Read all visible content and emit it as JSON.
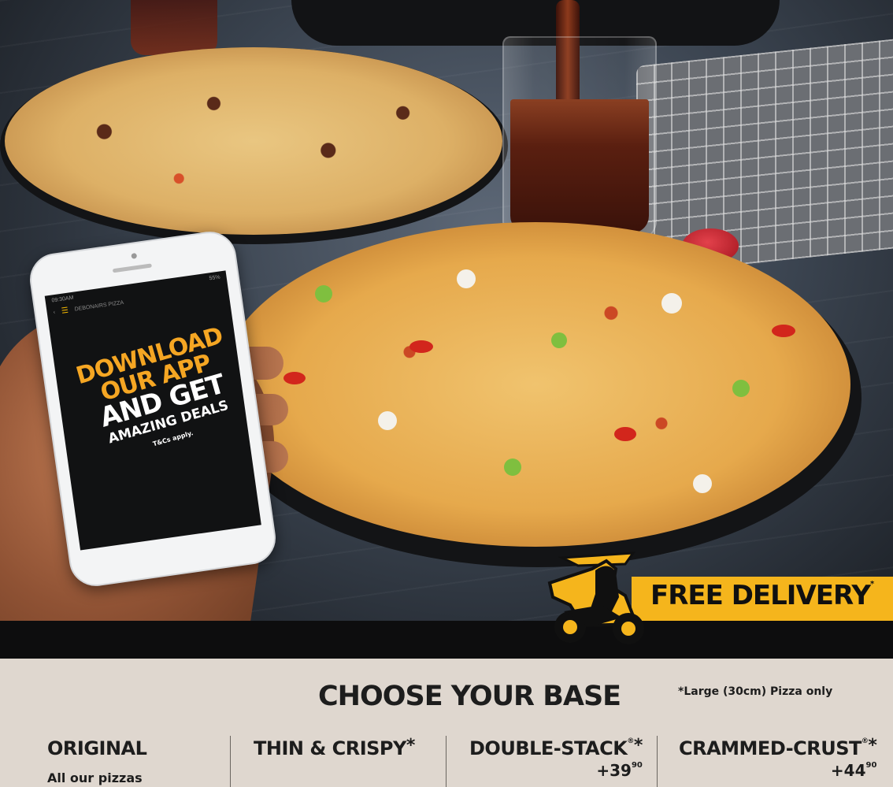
{
  "phone": {
    "status_time": "09:30AM",
    "status_right": "55%",
    "app_title": "DEBONAIRS PIZZA",
    "promo": {
      "line1": "DOWNLOAD",
      "line2": "OUR APP",
      "line3": "AND GET",
      "line4": "AMAZING DEALS",
      "terms": "T&Cs apply."
    }
  },
  "badge": {
    "text": "FREE DELIVERY",
    "mark": "*"
  },
  "base_section": {
    "title": "CHOOSE YOUR BASE",
    "note": "*Large (30cm) Pizza only",
    "options": [
      {
        "name": "ORIGINAL",
        "asterisk": "",
        "registered": "",
        "price_main": "",
        "price_cents": "",
        "desc": "All our pizzas"
      },
      {
        "name": "THIN & CRISPY",
        "asterisk": "*",
        "registered": "",
        "price_main": "",
        "price_cents": "",
        "desc": ""
      },
      {
        "name": "DOUBLE-STACK",
        "asterisk": "*",
        "registered": "®",
        "price_main": "+39",
        "price_cents": "90",
        "desc": ""
      },
      {
        "name": "CRAMMED-CRUST",
        "asterisk": "*",
        "registered": "®",
        "price_main": "+44",
        "price_cents": "90",
        "desc": ""
      }
    ]
  },
  "colors": {
    "accent_yellow": "#f5b51c",
    "promo_orange": "#f5a623",
    "section_bg": "#dfd7cf",
    "text_dark": "#1d1d1d"
  },
  "icons": {
    "scooter": "scooter-rider-icon",
    "menu": "hamburger-menu-icon",
    "back": "back-arrow-icon"
  }
}
